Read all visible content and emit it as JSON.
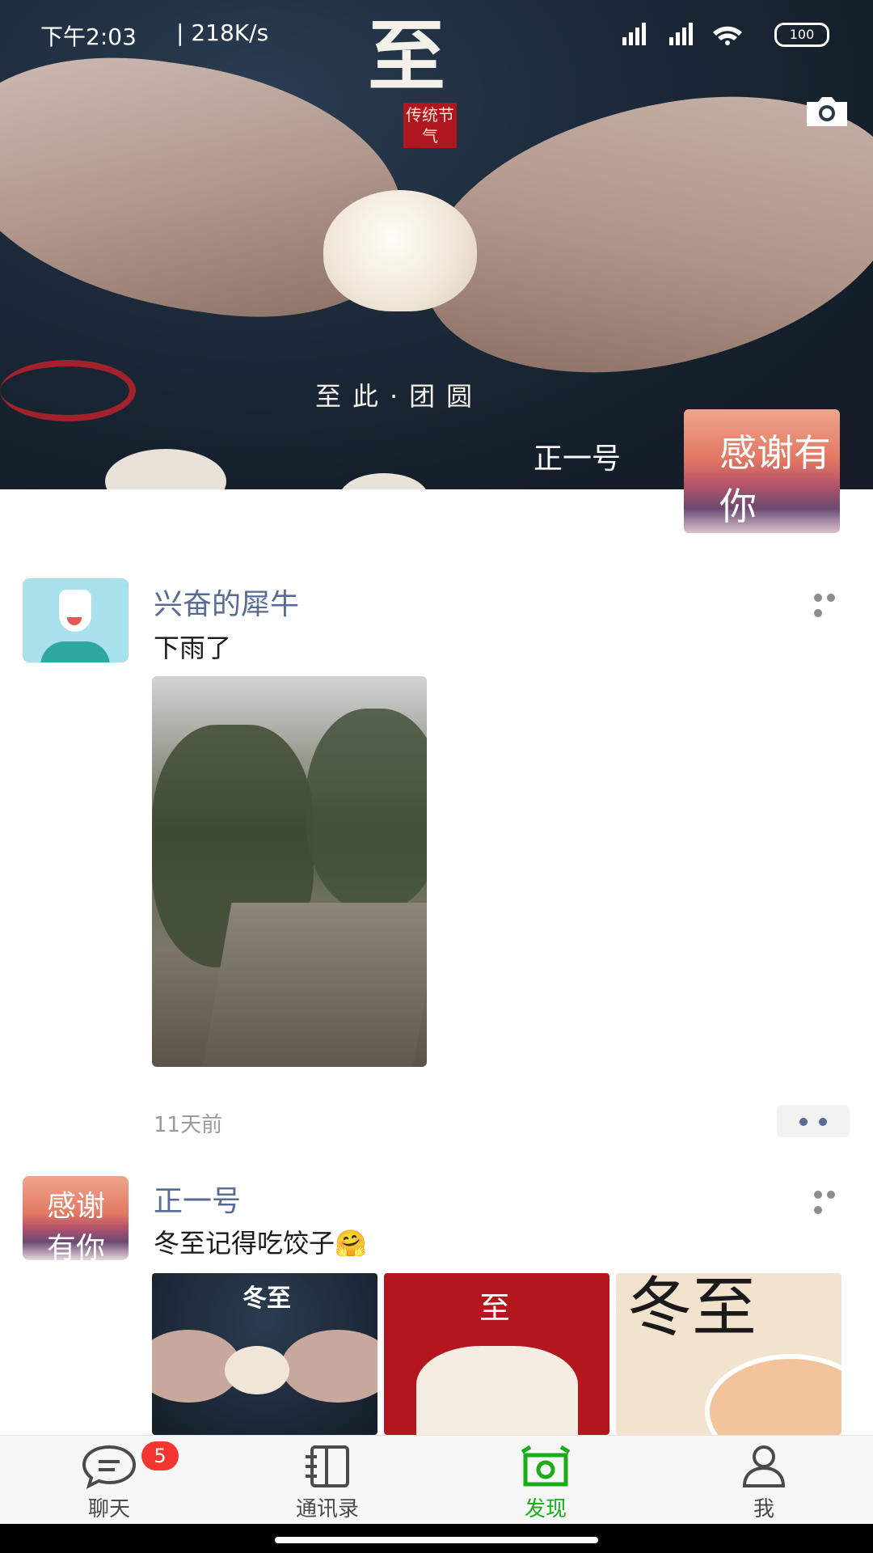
{
  "status_bar": {
    "time": "下午2:03",
    "network_speed": "| 218K/s",
    "battery": "100"
  },
  "cover": {
    "title": "至",
    "seal": "传统节气",
    "slogan": "至此·团圆",
    "owner_name": "正一号",
    "owner_avatar_text": "感谢有你"
  },
  "posts": [
    {
      "nickname": "兴奋的犀牛",
      "text": "下雨了",
      "time": "11天前"
    },
    {
      "nickname": "正一号",
      "text": "冬至记得吃饺子🤗",
      "thumbnails": [
        {
          "title": "冬至"
        },
        {
          "title": "至"
        },
        {
          "title": "冬至"
        }
      ]
    }
  ],
  "tabbar": {
    "items": [
      {
        "label": "聊天",
        "badge": "5"
      },
      {
        "label": "通讯录"
      },
      {
        "label": "发现"
      },
      {
        "label": "我"
      }
    ],
    "active_color": "#1aad19"
  }
}
